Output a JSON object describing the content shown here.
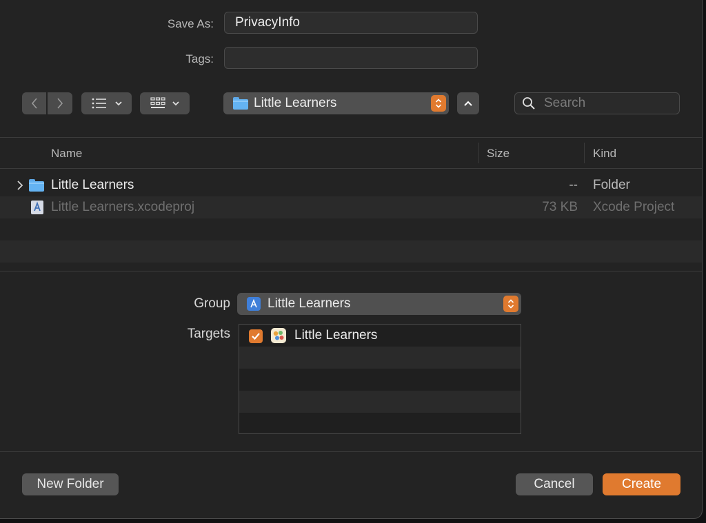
{
  "save_as": {
    "label": "Save As:",
    "value": "PrivacyInfo"
  },
  "tags": {
    "label": "Tags:",
    "value": ""
  },
  "toolbar": {
    "location": "Little Learners",
    "search_placeholder": "Search"
  },
  "columns": {
    "name": "Name",
    "size": "Size",
    "kind": "Kind"
  },
  "files": [
    {
      "name": "Little Learners",
      "size": "--",
      "kind": "Folder",
      "icon": "folder-icon",
      "enabled": true
    },
    {
      "name": "Little Learners.xcodeproj",
      "size": "73 KB",
      "kind": "Xcode Project",
      "icon": "xcodeproj-icon",
      "enabled": false
    }
  ],
  "group": {
    "label": "Group",
    "value": "Little Learners"
  },
  "targets": {
    "label": "Targets",
    "items": [
      {
        "name": "Little Learners",
        "checked": true
      }
    ]
  },
  "buttons": {
    "new_folder": "New Folder",
    "cancel": "Cancel",
    "create": "Create"
  },
  "colors": {
    "accent": "#E07A2F",
    "folder": "#64B3F2",
    "background": "#232323"
  }
}
